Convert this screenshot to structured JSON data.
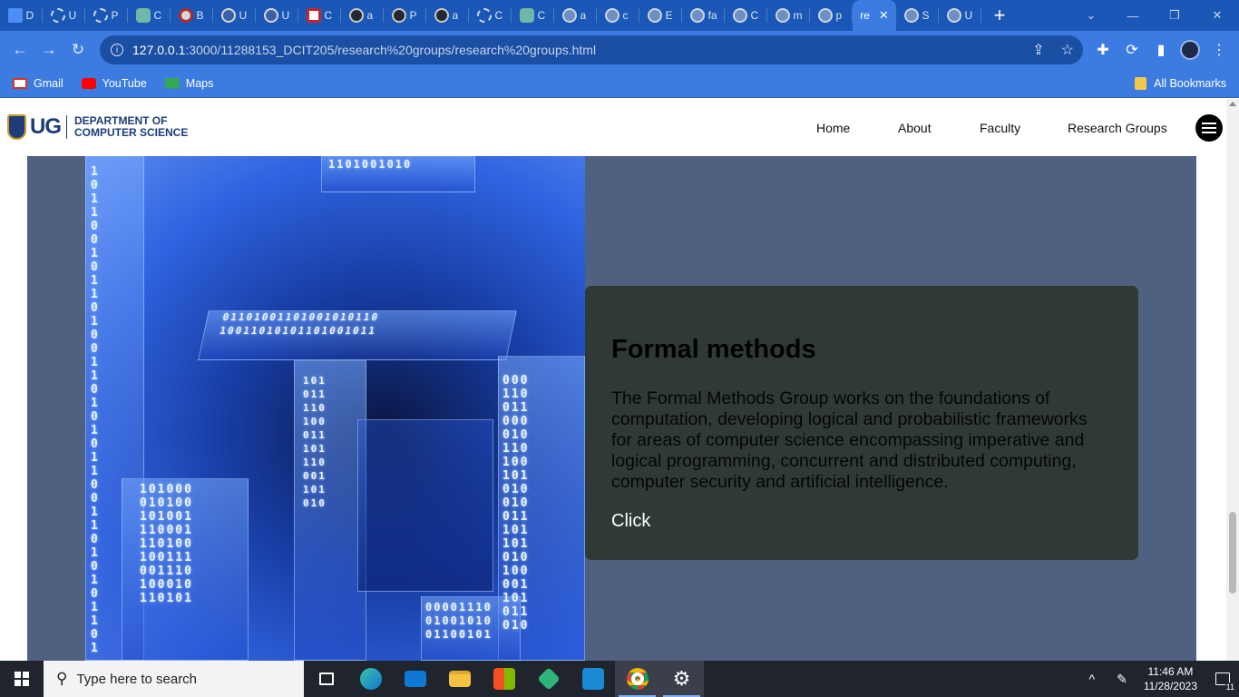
{
  "browser": {
    "tabs": [
      {
        "label": "D",
        "icon": "docs-icon",
        "style": "doc"
      },
      {
        "label": "U",
        "icon": "loading-icon",
        "style": "ring"
      },
      {
        "label": "P",
        "icon": "loading-icon",
        "style": "ring"
      },
      {
        "label": "C",
        "icon": "chatgpt-icon",
        "style": "gpt"
      },
      {
        "label": "B",
        "icon": "site-icon",
        "style": "red"
      },
      {
        "label": "U",
        "icon": "ug-icon",
        "style": "ug"
      },
      {
        "label": "U",
        "icon": "ug-icon",
        "style": "ug"
      },
      {
        "label": "C",
        "icon": "site-icon",
        "style": "sq"
      },
      {
        "label": "a",
        "icon": "github-icon",
        "style": "gh"
      },
      {
        "label": "P",
        "icon": "github-icon",
        "style": "gh"
      },
      {
        "label": "a",
        "icon": "github-icon",
        "style": "gh"
      },
      {
        "label": "C",
        "icon": "loading-icon",
        "style": "ring"
      },
      {
        "label": "C",
        "icon": "chatgpt-icon",
        "style": "gpt"
      },
      {
        "label": "a",
        "icon": "globe-icon",
        "style": "globe"
      },
      {
        "label": "c",
        "icon": "globe-icon",
        "style": "globe"
      },
      {
        "label": "E",
        "icon": "globe-icon",
        "style": "globe"
      },
      {
        "label": "fa",
        "icon": "globe-icon",
        "style": "globe"
      },
      {
        "label": "C",
        "icon": "globe-icon",
        "style": "globe"
      },
      {
        "label": "m",
        "icon": "globe-icon",
        "style": "globe"
      },
      {
        "label": "p",
        "icon": "globe-icon",
        "style": "globe"
      }
    ],
    "active_tab": {
      "label": "re",
      "close": "✕"
    },
    "tabs_after": [
      {
        "label": "S",
        "icon": "globe-icon",
        "style": "globe"
      },
      {
        "label": "U",
        "icon": "globe-icon",
        "style": "globe"
      }
    ],
    "new_tab": "+",
    "window": {
      "dropdown": "⌄",
      "minimize": "—",
      "restore": "❐",
      "close": "✕"
    },
    "nav": {
      "back": "←",
      "forward": "→",
      "reload": "↻"
    },
    "url_info": "i",
    "url_host": "127.0.0.1",
    "url_path": ":3000/11288153_DCIT205/research%20groups/research%20groups.html",
    "url_actions": {
      "share": "⇪",
      "star": "☆"
    },
    "extensions": {
      "puzzle": "✚",
      "sync": "⟳",
      "sidebar": "▮",
      "menu": "⋮"
    },
    "bookmarks": [
      {
        "label": "Gmail",
        "icon": "gmail-icon"
      },
      {
        "label": "YouTube",
        "icon": "youtube-icon"
      },
      {
        "label": "Maps",
        "icon": "maps-icon"
      }
    ],
    "all_bookmarks": "All Bookmarks"
  },
  "site": {
    "logo_text": "UG",
    "dept_line1": "DEPARTMENT OF",
    "dept_line2": "COMPUTER SCIENCE",
    "nav": [
      "Home",
      "About",
      "Faculty",
      "Research Groups"
    ]
  },
  "group": {
    "title": "Formal methods",
    "description": "The Formal Methods Group works on the foundations of computation, developing logical and probabilistic frameworks for areas of computer science encompassing imperative and logical programming, concurrent and distributed computing, computer security and artificial intelligence.",
    "link": "Click"
  },
  "taskbar": {
    "search_placeholder": "Type here to search",
    "apps": [
      "task-view-icon",
      "edge-icon",
      "mail-icon",
      "file-explorer-icon",
      "store-icon",
      "git-icon",
      "vscode-icon",
      "chrome-icon",
      "settings-icon"
    ],
    "active_apps": [
      "chrome-icon",
      "settings-icon"
    ],
    "time": "11:46 AM",
    "date": "11/28/2023",
    "notifications": "11",
    "tray_chevron": "^"
  }
}
